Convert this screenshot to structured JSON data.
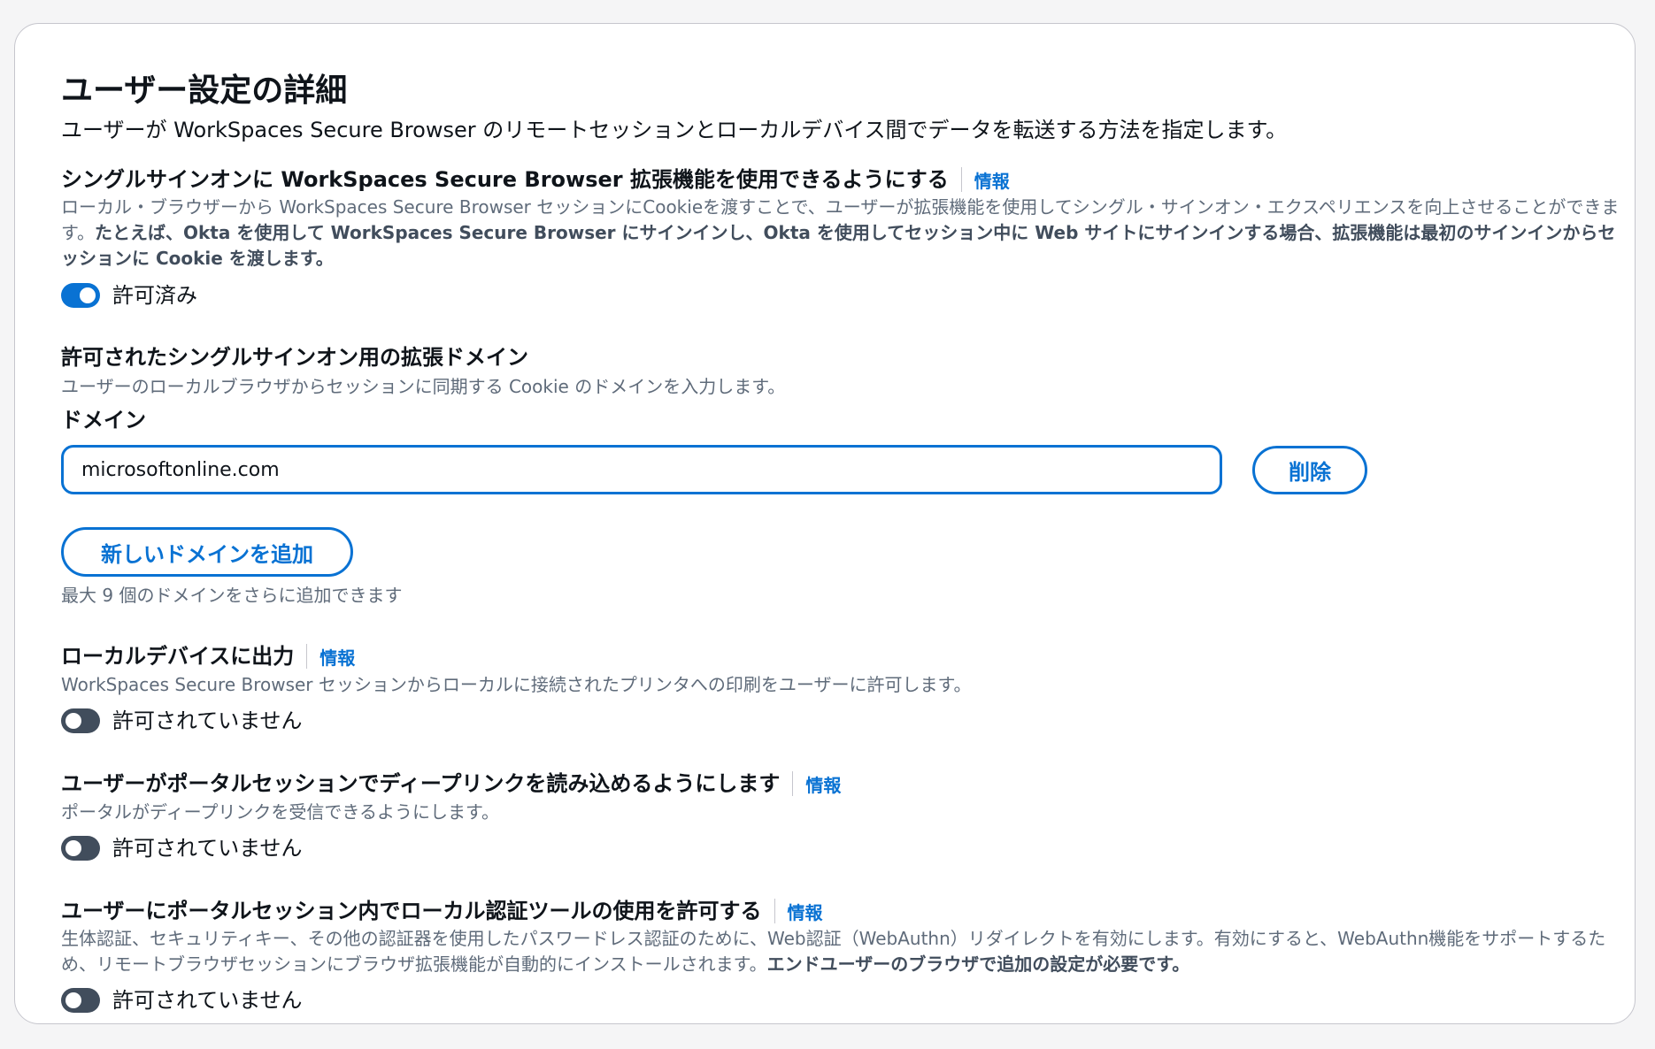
{
  "title": "ユーザー設定の詳細",
  "subtitle": "ユーザーが WorkSpaces Secure Browser のリモートセッションとローカルデバイス間でデータを転送する方法を指定します。",
  "info_label": "情報",
  "sso": {
    "label": "シングルサインオンに WorkSpaces Secure Browser 拡張機能を使用できるようにする",
    "description_plain": "ローカル・ブラウザーから WorkSpaces Secure Browser セッションにCookieを渡すことで、ユーザーが拡張機能を使用してシングル・サインオン・エクスペリエンスを向上させることができます。",
    "description_bold": "たとえば、Okta を使用して WorkSpaces Secure Browser にサインインし、Okta を使用してセッション中に Web サイトにサインインする場合、拡張機能は最初のサインインからセッションに Cookie を渡します。",
    "toggle_on": true,
    "toggle_text": "許可済み"
  },
  "domains": {
    "label": "許可されたシングルサインオン用の拡張ドメイン",
    "description": "ユーザーのローカルブラウザからセッションに同期する Cookie のドメインを入力します。",
    "field_label": "ドメイン",
    "value": "microsoftonline.com",
    "delete_button": "削除",
    "add_button": "新しいドメインを追加",
    "add_hint": "最大 9 個のドメインをさらに追加できます"
  },
  "print": {
    "label": "ローカルデバイスに出力",
    "description": "WorkSpaces Secure Browser セッションからローカルに接続されたプリンタへの印刷をユーザーに許可します。",
    "toggle_on": false,
    "toggle_text": "許可されていません"
  },
  "deeplink": {
    "label": "ユーザーがポータルセッションでディープリンクを読み込めるようにします",
    "description": "ポータルがディープリンクを受信できるようにします。",
    "toggle_on": false,
    "toggle_text": "許可されていません"
  },
  "webauthn": {
    "label": "ユーザーにポータルセッション内でローカル認証ツールの使用を許可する",
    "description_plain": "生体認証、セキュリティキー、その他の認証器を使用したパスワードレス認証のために、Web認証（WebAuthn）リダイレクトを有効にします。有効にすると、WebAuthn機能をサポートするため、リモートブラウザセッションにブラウザ拡張機能が自動的にインストールされます。",
    "description_bold": "エンドユーザーのブラウザで追加の設定が必要です。",
    "toggle_on": false,
    "toggle_text": "許可されていません"
  },
  "colors": {
    "accent": "#0972d3",
    "toggle_off": "#414d5c",
    "secondary_text": "#5f6b7a",
    "border": "#c6c6cd"
  }
}
